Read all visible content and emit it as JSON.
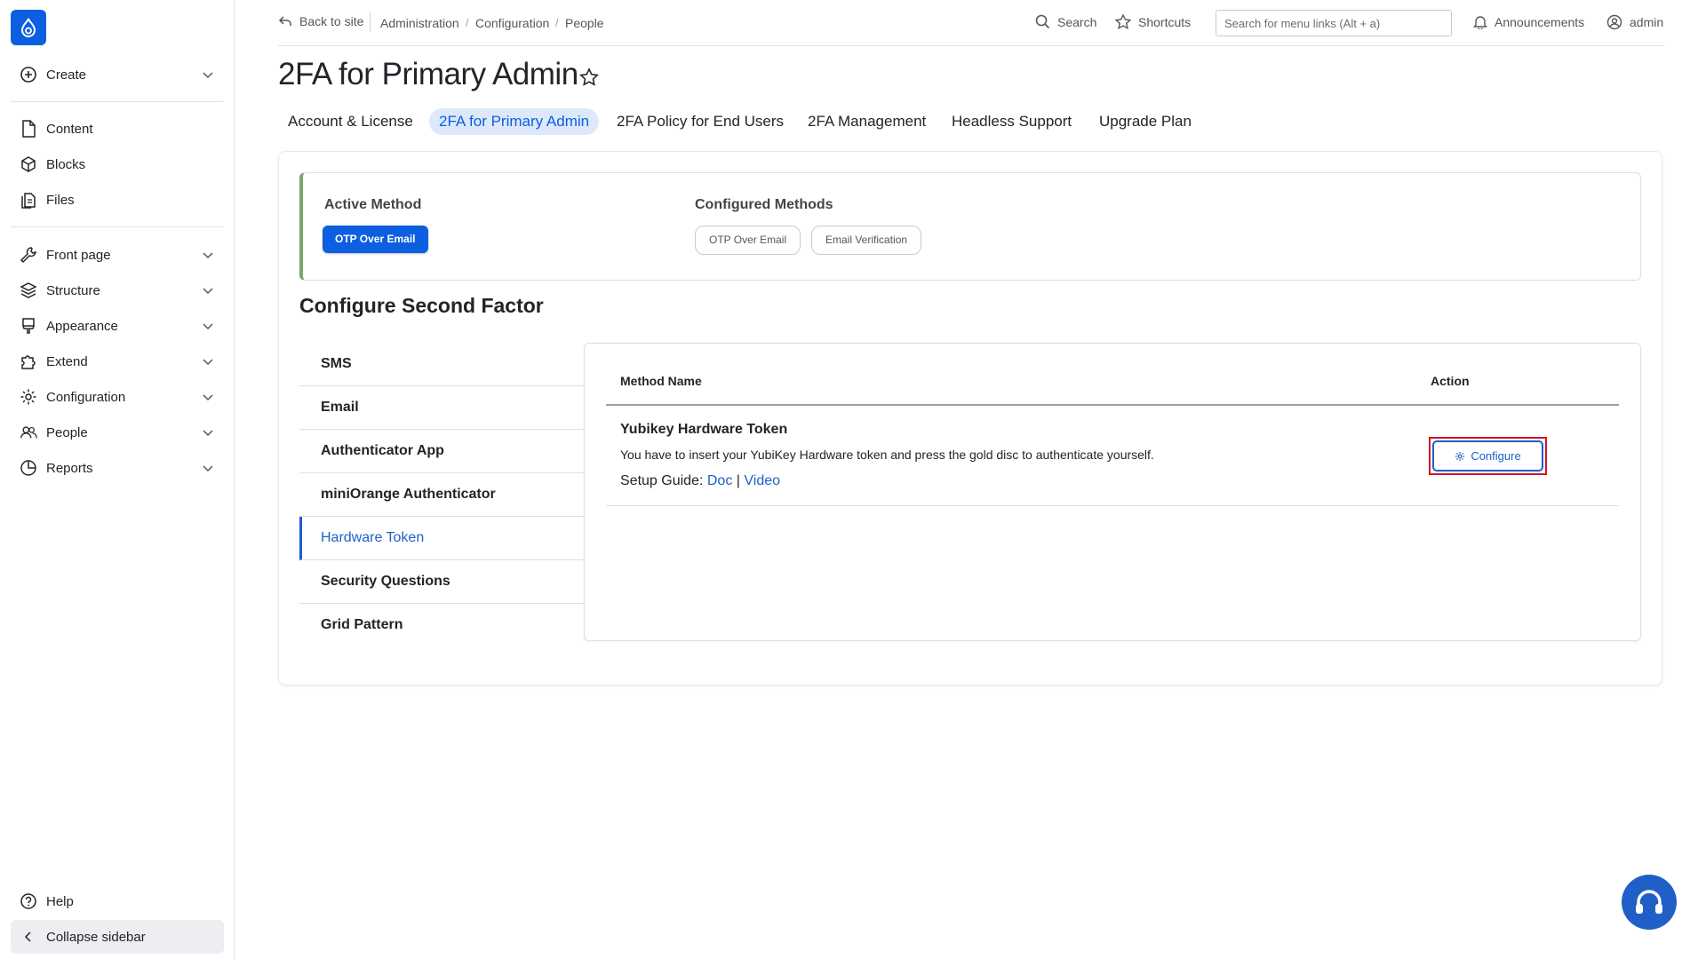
{
  "sidebar": {
    "create": "Create",
    "items": [
      {
        "label": "Content"
      },
      {
        "label": "Blocks"
      },
      {
        "label": "Files"
      },
      {
        "label": "Front page"
      },
      {
        "label": "Structure"
      },
      {
        "label": "Appearance"
      },
      {
        "label": "Extend"
      },
      {
        "label": "Configuration"
      },
      {
        "label": "People"
      },
      {
        "label": "Reports"
      }
    ],
    "help": "Help",
    "collapse": "Collapse sidebar"
  },
  "topbar": {
    "back": "Back to site",
    "breadcrumb": [
      "Administration",
      "Configuration",
      "People"
    ],
    "search": "Search",
    "shortcuts": "Shortcuts",
    "menu_search_placeholder": "Search for menu links (Alt + a)",
    "announcements": "Announcements",
    "user": "admin"
  },
  "page": {
    "title": "2FA for Primary Admin",
    "tabs": [
      {
        "label": "Account & License"
      },
      {
        "label": "2FA for Primary Admin",
        "active": true
      },
      {
        "label": "2FA Policy for End Users"
      },
      {
        "label": "2FA Management"
      },
      {
        "label": "Headless Support"
      },
      {
        "label": "Upgrade Plan"
      }
    ]
  },
  "methods": {
    "active_label": "Active Method",
    "active_value": "OTP Over Email",
    "configured_label": "Configured Methods",
    "configured": [
      "OTP Over Email",
      "Email Verification"
    ]
  },
  "configure": {
    "title": "Configure Second Factor",
    "list": [
      "SMS",
      "Email",
      "Authenticator App",
      "miniOrange Authenticator",
      "Hardware Token",
      "Security Questions",
      "Grid Pattern"
    ],
    "selected": "Hardware Token",
    "table": {
      "col_method": "Method Name",
      "col_action": "Action",
      "row": {
        "name": "Yubikey Hardware Token",
        "description": "You have to insert your YubiKey Hardware token and press the gold disc to authenticate yourself.",
        "guide_label": "Setup Guide:",
        "doc": "Doc",
        "separator": "|",
        "video": "Video",
        "action": "Configure"
      }
    }
  },
  "colors": {
    "brand": "#0c5fe0",
    "link": "#1f5fc7",
    "highlight": "#d0132b",
    "active_border": "#7fa56b"
  },
  "icons": [
    "drupal-logo-icon",
    "plus-circle-icon",
    "file-icon",
    "cube-icon",
    "files-icon",
    "wrench-icon",
    "layers-icon",
    "brush-icon",
    "puzzle-icon",
    "gear-icon",
    "people-icon",
    "chart-icon",
    "chevron-down-icon",
    "back-arrow-icon",
    "search-icon",
    "star-icon",
    "bell-icon",
    "user-icon",
    "help-icon",
    "chevron-left-icon",
    "headset-icon"
  ]
}
